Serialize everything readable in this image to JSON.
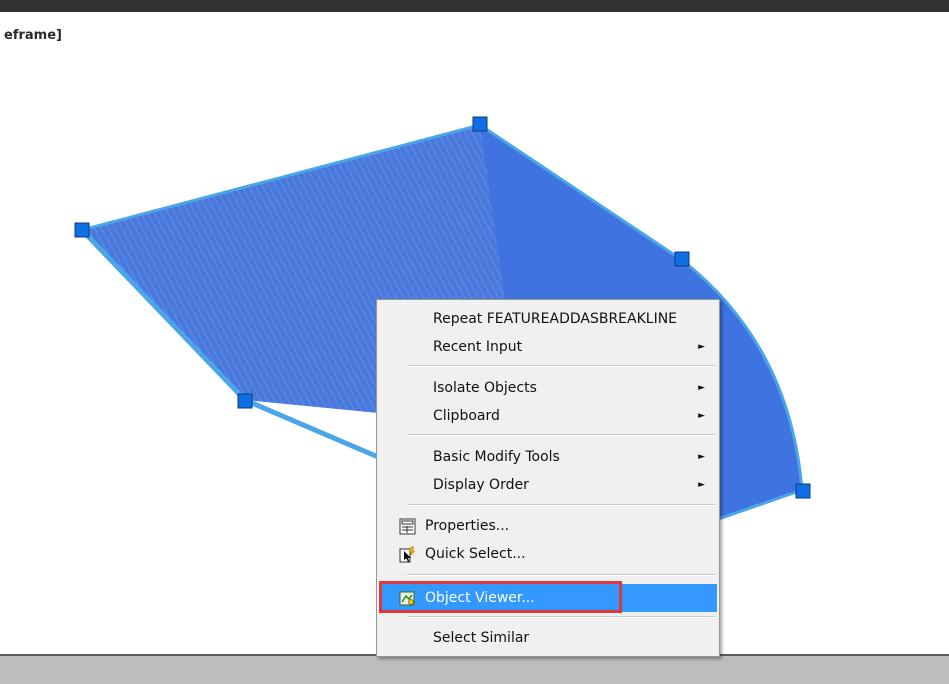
{
  "viewport": {
    "label": "eframe]"
  },
  "colors": {
    "selection_fill": "#3f74e0",
    "selection_edge": "#4aa6e8",
    "grip": "#0f6fe5",
    "menu_highlight": "#3399ff",
    "callout": "#e0373a"
  },
  "context_menu": {
    "repeat": {
      "label": "Repeat FEATUREADDASBREAKLINE"
    },
    "recent_input": {
      "label": "Recent Input",
      "submenu_arrow": "►"
    },
    "isolate_objects": {
      "label": "Isolate Objects",
      "submenu_arrow": "►"
    },
    "clipboard": {
      "label": "Clipboard",
      "submenu_arrow": "►"
    },
    "basic_modify_tools": {
      "label": "Basic Modify Tools",
      "submenu_arrow": "►"
    },
    "display_order": {
      "label": "Display Order",
      "submenu_arrow": "►"
    },
    "properties": {
      "label": "Properties...",
      "icon": "properties-icon"
    },
    "quick_select": {
      "label": "Quick Select...",
      "icon": "quick-select-icon"
    },
    "object_viewer": {
      "label": "Object Viewer...",
      "icon": "object-viewer-icon",
      "highlighted": true
    },
    "select_similar": {
      "label": "Select Similar"
    }
  }
}
